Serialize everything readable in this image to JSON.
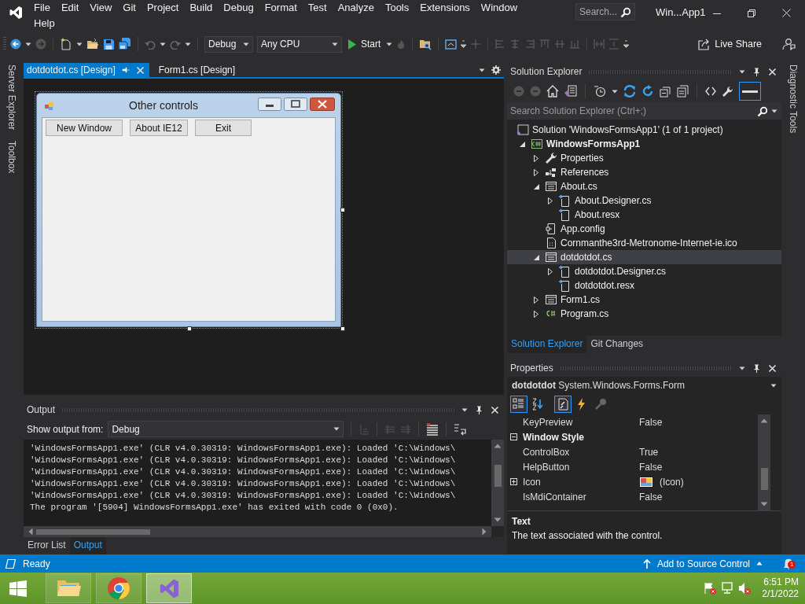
{
  "menu": [
    "File",
    "Edit",
    "View",
    "Git",
    "Project",
    "Build",
    "Debug",
    "Format",
    "Test",
    "Analyze",
    "Tools",
    "Extensions",
    "Window",
    "Help"
  ],
  "search": {
    "placeholder": "Search..."
  },
  "title": "Win...App1",
  "toolbar": {
    "configuration": "Debug",
    "platform": "Any CPU",
    "start": "Start",
    "live_share": "Live Share"
  },
  "side_tabs_left": [
    "Server Explorer",
    "Toolbox"
  ],
  "side_tabs_right": [
    "Diagnostic Tools"
  ],
  "document_tabs": [
    {
      "label": "dotdotdot.cs [Design]",
      "selected": true
    },
    {
      "label": "Form1.cs [Design]",
      "selected": false
    }
  ],
  "form_preview": {
    "title": "Other controls",
    "buttons": [
      "New Window",
      "About IE12",
      "Exit"
    ]
  },
  "output": {
    "title": "Output",
    "source_label": "Show output from:",
    "source": "Debug",
    "lines": [
      "'WindowsFormsApp1.exe' (CLR v4.0.30319: WindowsFormsApp1.exe): Loaded 'C:\\Windows\\",
      "'WindowsFormsApp1.exe' (CLR v4.0.30319: WindowsFormsApp1.exe): Loaded 'C:\\Windows\\",
      "'WindowsFormsApp1.exe' (CLR v4.0.30319: WindowsFormsApp1.exe): Loaded 'C:\\Windows\\",
      "'WindowsFormsApp1.exe' (CLR v4.0.30319: WindowsFormsApp1.exe): Loaded 'C:\\Windows\\",
      "'WindowsFormsApp1.exe' (CLR v4.0.30319: WindowsFormsApp1.exe): Loaded 'C:\\Windows\\",
      "The program '[5904] WindowsFormsApp1.exe' has exited with code 0 (0x0)."
    ],
    "tabs": [
      {
        "label": "Error List",
        "selected": false
      },
      {
        "label": "Output",
        "selected": true
      }
    ]
  },
  "solution_explorer": {
    "title": "Solution Explorer",
    "search": {
      "placeholder": "Search Solution Explorer (Ctrl+;)"
    },
    "tree": [
      {
        "label": "Solution 'WindowsFormsApp1' (1 of 1 project)",
        "kind": "solution",
        "selected": false,
        "children": [
          {
            "label": "WindowsFormsApp1",
            "kind": "project",
            "expanded": true,
            "selected": false,
            "children": [
              {
                "label": "Properties",
                "kind": "wrench",
                "expanded": false,
                "selected": false
              },
              {
                "label": "References",
                "kind": "references",
                "expanded": false,
                "selected": false
              },
              {
                "label": "About.cs",
                "kind": "form",
                "expanded": true,
                "selected": false,
                "children": [
                  {
                    "label": "About.Designer.cs",
                    "kind": "resource",
                    "expanded": false,
                    "selected": false
                  },
                  {
                    "label": "About.resx",
                    "kind": "resource",
                    "selected": false
                  }
                ]
              },
              {
                "label": "App.config",
                "kind": "config",
                "selected": false
              },
              {
                "label": "Cornmanthe3rd-Metronome-Internet-ie.ico",
                "kind": "file",
                "selected": false
              },
              {
                "label": "dotdotdot.cs",
                "kind": "form",
                "expanded": true,
                "selected": true,
                "children": [
                  {
                    "label": "dotdotdot.Designer.cs",
                    "kind": "resource",
                    "expanded": false,
                    "selected": false
                  },
                  {
                    "label": "dotdotdot.resx",
                    "kind": "resource",
                    "selected": false
                  }
                ]
              },
              {
                "label": "Form1.cs",
                "kind": "form",
                "expanded": false,
                "selected": false
              },
              {
                "label": "Program.cs",
                "kind": "csharp",
                "expanded": false,
                "selected": false
              }
            ]
          }
        ]
      }
    ],
    "tabs": [
      {
        "label": "Solution Explorer",
        "selected": true
      },
      {
        "label": "Git Changes",
        "selected": false
      }
    ]
  },
  "properties": {
    "title": "Properties",
    "object": "dotdotdot",
    "type": "System.Windows.Forms.Form",
    "view_buttons": [
      {
        "kind": "categorized",
        "selected": true
      },
      {
        "kind": "alphabetical",
        "selected": false
      },
      {
        "kind": "properties",
        "selected": true
      },
      {
        "kind": "events",
        "selected": false
      },
      {
        "kind": "pages",
        "selected": false
      }
    ],
    "rows": [
      {
        "kind": "property",
        "name": "KeyPreview",
        "value": "False"
      },
      {
        "kind": "category",
        "name": "Window Style",
        "expanded": true
      },
      {
        "kind": "property",
        "name": "ControlBox",
        "value": "True"
      },
      {
        "kind": "property",
        "name": "HelpButton",
        "value": "False"
      },
      {
        "kind": "image_property",
        "name": "Icon",
        "value": "(Icon)",
        "expanded": false
      },
      {
        "kind": "property",
        "name": "IsMdiContainer",
        "value": "False"
      }
    ],
    "description": {
      "title": "Text",
      "text": "The text associated with the control."
    }
  },
  "status_bar": {
    "text": "Ready",
    "source_control": "Add to Source Control",
    "notifications": "1"
  },
  "taskbar": {
    "apps": [
      {
        "kind": "folder",
        "selected": false
      },
      {
        "kind": "browser",
        "selected": false
      },
      {
        "kind": "vs",
        "selected": true
      }
    ],
    "time": "6:51 PM",
    "date": "2/1/2022"
  }
}
